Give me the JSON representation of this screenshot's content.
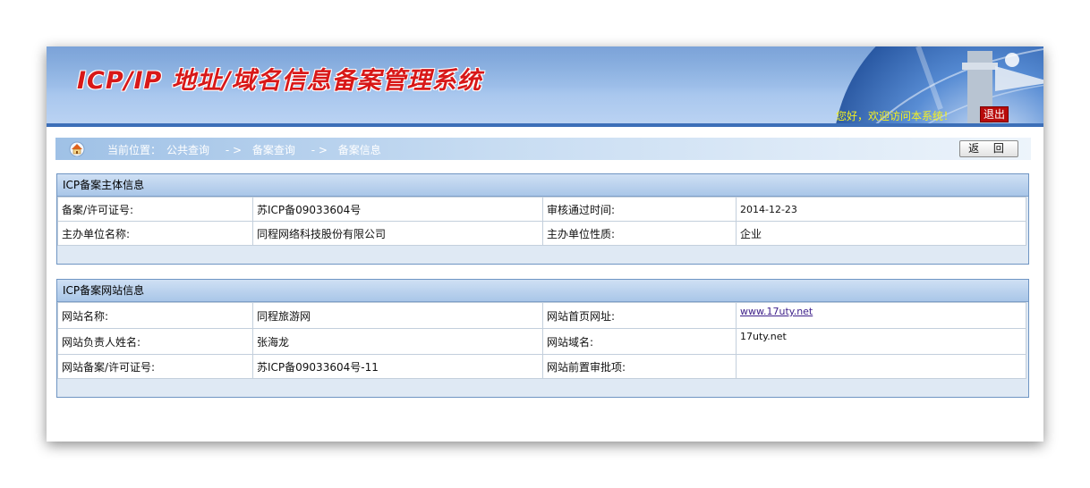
{
  "header": {
    "title": "ICP/IP 地址/域名信息备案管理系统",
    "welcome": "您好，欢迎访问本系统！",
    "logout_label": "退出"
  },
  "breadcrumb": {
    "prefix": "当前位置：",
    "items": [
      "公共查询",
      "备案查询",
      "备案信息"
    ],
    "separator": "- >",
    "back_label": "返 回"
  },
  "subject": {
    "heading": "ICP备案主体信息",
    "rows": [
      {
        "label1": "备案/许可证号:",
        "value1": "苏ICP备09033604号",
        "label2": "审核通过时间:",
        "value2": "2014-12-23"
      },
      {
        "label1": "主办单位名称:",
        "value1": "同程网络科技股份有限公司",
        "label2": "主办单位性质:",
        "value2": "企业"
      }
    ]
  },
  "website": {
    "heading": "ICP备案网站信息",
    "rows": [
      {
        "label1": "网站名称:",
        "value1": "同程旅游网",
        "label2": "网站首页网址:",
        "value2": "www.17uty.net"
      },
      {
        "label1": "网站负责人姓名:",
        "value1": "张海龙",
        "label2": "网站域名:",
        "value2": "17uty.net"
      },
      {
        "label1": "网站备案/许可证号:",
        "value1": "苏ICP备09033604号-11",
        "label2": "网站前置审批项:",
        "value2": ""
      }
    ]
  },
  "colors": {
    "title_red": "#d81818",
    "banner_blue": "#8cb2e2",
    "welcome_yellow": "#f4f020",
    "logout_red": "#b80b0b"
  }
}
